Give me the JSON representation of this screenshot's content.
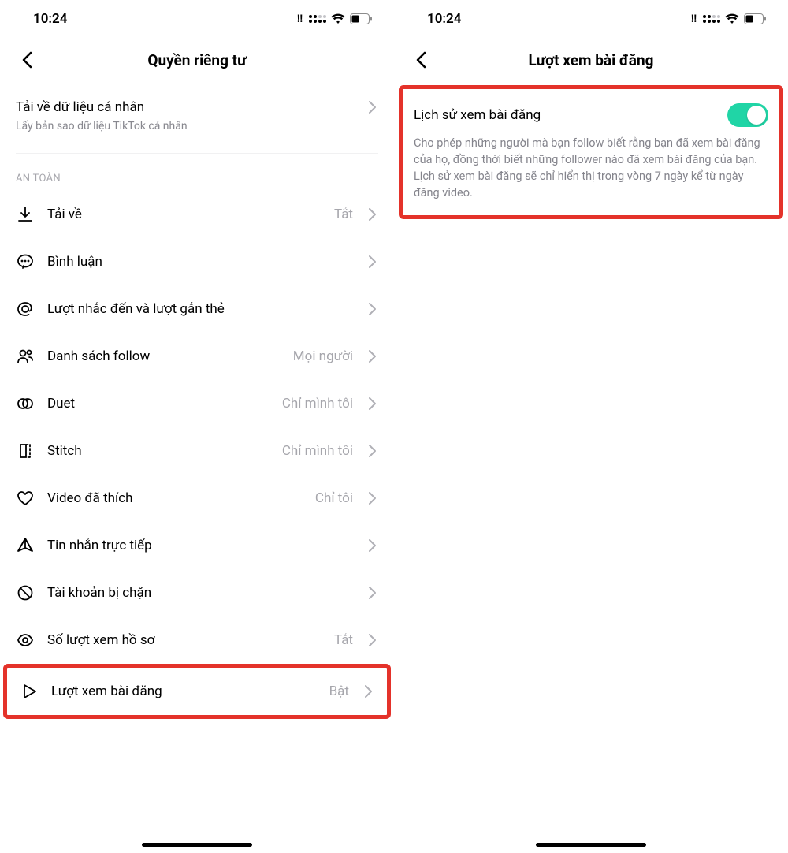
{
  "status": {
    "time": "10:24"
  },
  "left": {
    "title": "Quyền riêng tư",
    "data_row": {
      "title": "Tải về dữ liệu cá nhân",
      "subtitle": "Lấy bản sao dữ liệu TikTok cá nhân"
    },
    "section_label": "AN TOÀN",
    "items": [
      {
        "icon": "download",
        "label": "Tải về",
        "value": "Tắt"
      },
      {
        "icon": "comment",
        "label": "Bình luận",
        "value": ""
      },
      {
        "icon": "mention",
        "label": "Lượt nhắc đến và lượt gắn thẻ",
        "value": ""
      },
      {
        "icon": "follow",
        "label": "Danh sách follow",
        "value": "Mọi người"
      },
      {
        "icon": "duet",
        "label": "Duet",
        "value": "Chỉ mình tôi"
      },
      {
        "icon": "stitch",
        "label": "Stitch",
        "value": "Chỉ mình tôi"
      },
      {
        "icon": "heart",
        "label": "Video đã thích",
        "value": "Chỉ tôi"
      },
      {
        "icon": "send",
        "label": "Tin nhắn trực tiếp",
        "value": ""
      },
      {
        "icon": "block",
        "label": "Tài khoản bị chặn",
        "value": ""
      },
      {
        "icon": "eye",
        "label": "Số lượt xem hồ sơ",
        "value": "Tắt"
      },
      {
        "icon": "play",
        "label": "Lượt xem bài đăng",
        "value": "Bật"
      }
    ]
  },
  "right": {
    "title": "Lượt xem bài đăng",
    "toggle": {
      "label": "Lịch sử xem bài đăng",
      "on": true,
      "description": "Cho phép những người mà bạn follow biết rằng bạn đã xem bài đăng của họ, đồng thời biết những follower nào đã xem bài đăng của bạn. Lịch sử xem bài đăng sẽ chỉ hiển thị trong vòng 7 ngày kể từ ngày đăng video."
    }
  }
}
